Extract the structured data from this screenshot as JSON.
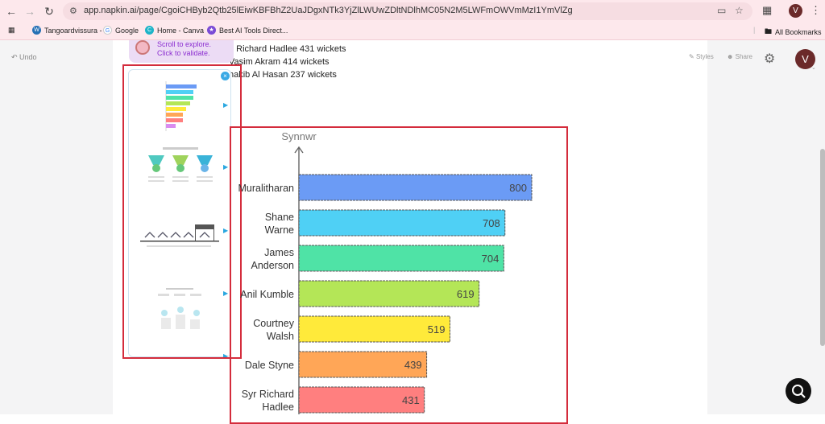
{
  "browser": {
    "url": "app.napkin.ai/page/CgoiCHByb2Qtb25lEiwKBFBhZ2UaJDgxNTk3YjZlLWUwZDltNDlhMC05N2M5LWFmOWVmMzI1YmVlZg",
    "profile_initial": "V",
    "bookmarks": [
      "Tangoardvissura -",
      "Google",
      "Home - Canva",
      "Best AI Tools Direct..."
    ],
    "all_bookmarks": "All Bookmarks"
  },
  "toolbar": {
    "undo": "Undo",
    "styles": "Styles",
    "share": "Share",
    "avatar_initial": "V"
  },
  "doc": {
    "lines": [
      "ir Richard Hadlee 431 wickets",
      "Vasim Akram 414 wickets",
      "hakib Al Hasan 237 wickets"
    ]
  },
  "tooltip": {
    "line1": "Scroll to explore.",
    "line2": "Click to validate."
  },
  "chart_data": {
    "type": "bar",
    "orientation": "horizontal",
    "ylabel": "Synnwr",
    "categories": [
      "Muralitharan",
      "Shane Warne",
      "James Anderson",
      "Anil Kumble",
      "Courtney Walsh",
      "Dale Styne",
      "Syr Richard Hadlee"
    ],
    "category_lines": [
      [
        "Muralitharan"
      ],
      [
        "Shane",
        "Warne"
      ],
      [
        "James",
        "Anderson"
      ],
      [
        "Anil Kumble"
      ],
      [
        "Courtney",
        "Walsh"
      ],
      [
        "Dale Styne"
      ],
      [
        "Syr Richard",
        "Hadlee"
      ]
    ],
    "values": [
      800,
      708,
      704,
      619,
      519,
      439,
      431
    ],
    "colors": [
      "#6b9bf5",
      "#4fd0f5",
      "#4fe3a6",
      "#b4e657",
      "#ffea3a",
      "#ffa657",
      "#ff7f7f"
    ],
    "xlim": [
      0,
      800
    ]
  }
}
